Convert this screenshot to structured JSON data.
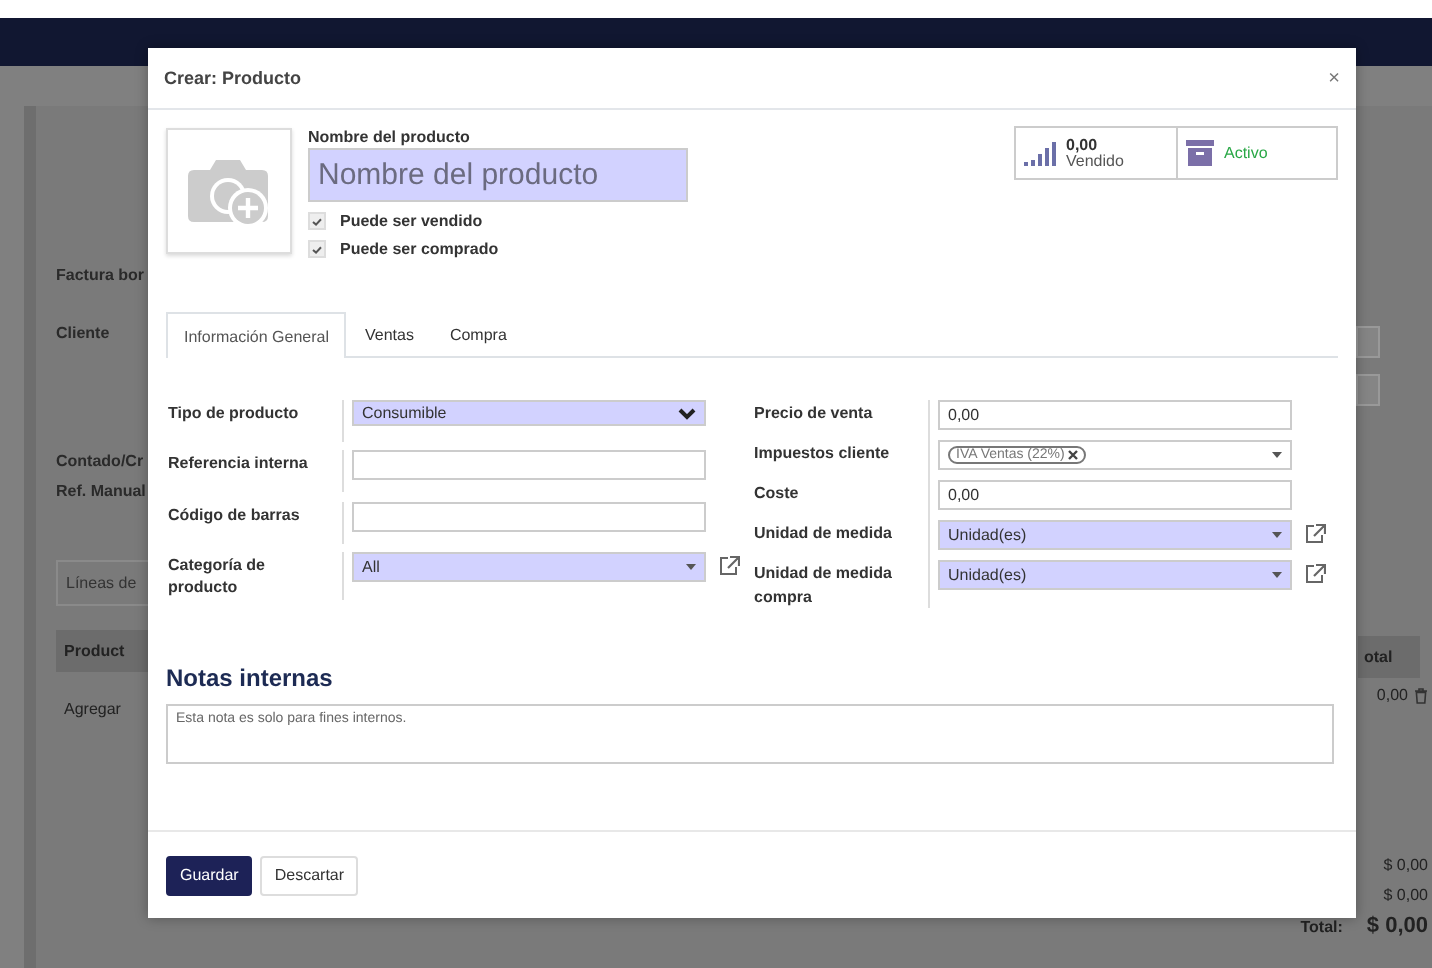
{
  "background_page": {
    "form_labels": [
      "Factura bor",
      "Cliente"
    ],
    "form_labels_2": [
      "Contado/Cr",
      "Ref. Manual"
    ],
    "tab": "Líneas de",
    "column_header": "Product",
    "add_link": "Agregar",
    "column_header_2": "otal",
    "line_amount": "0,00",
    "subtotals": [
      "$ 0,00",
      "$ 0,00"
    ],
    "total_label": "Total:",
    "total": "$ 0,00"
  },
  "dialog": {
    "title": "Crear: Producto",
    "close": "×",
    "name_label": "Nombre del producto",
    "name_field": {
      "placeholder": "Nombre del producto",
      "required": true
    },
    "checkboxes": [
      {
        "label": "Puede ser vendido",
        "checked": true
      },
      {
        "label": "Puede ser comprado",
        "checked": true
      }
    ],
    "stats": [
      {
        "kind": "sales",
        "value": "0,00",
        "label": "Vendido"
      },
      {
        "kind": "archive",
        "label": "Activo"
      }
    ],
    "tabs": [
      {
        "label": "Información General",
        "selected": true
      },
      {
        "label": "Ventas",
        "selected": false
      },
      {
        "label": "Compra",
        "selected": false
      }
    ],
    "left_fields": [
      {
        "label": "Tipo de producto",
        "kind": "selection",
        "value": "Consumible",
        "required": true,
        "link": false
      },
      {
        "label": "Referencia interna",
        "kind": "text",
        "required": false,
        "link": false
      },
      {
        "label": "Código de barras",
        "kind": "text",
        "required": false,
        "link": false
      },
      {
        "label": "Categoría de producto",
        "kind": "relation",
        "value": "All",
        "required": true,
        "link": true
      }
    ],
    "right_fields": [
      {
        "label": "Precio de venta",
        "kind": "text",
        "value": "0,00",
        "required": false,
        "link": false
      },
      {
        "label": "Impuestos cliente",
        "kind": "tags",
        "tags": [
          "IVA Ventas (22%)"
        ],
        "required": false,
        "link": false
      },
      {
        "label": "Coste",
        "kind": "text",
        "value": "0,00",
        "required": false,
        "link": false
      },
      {
        "label": "Unidad de medida",
        "kind": "relation",
        "value": "Unidad(es)",
        "required": true,
        "link": true
      },
      {
        "label": "Unidad de medida compra",
        "kind": "relation",
        "value": "Unidad(es)",
        "required": true,
        "link": true
      }
    ],
    "notes": {
      "title": "Notas internas",
      "placeholder": "Esta nota es solo para fines internos."
    },
    "buttons": [
      {
        "label": "Guardar",
        "kind": "primary"
      },
      {
        "label": "Descartar",
        "kind": "secondary"
      }
    ]
  }
}
